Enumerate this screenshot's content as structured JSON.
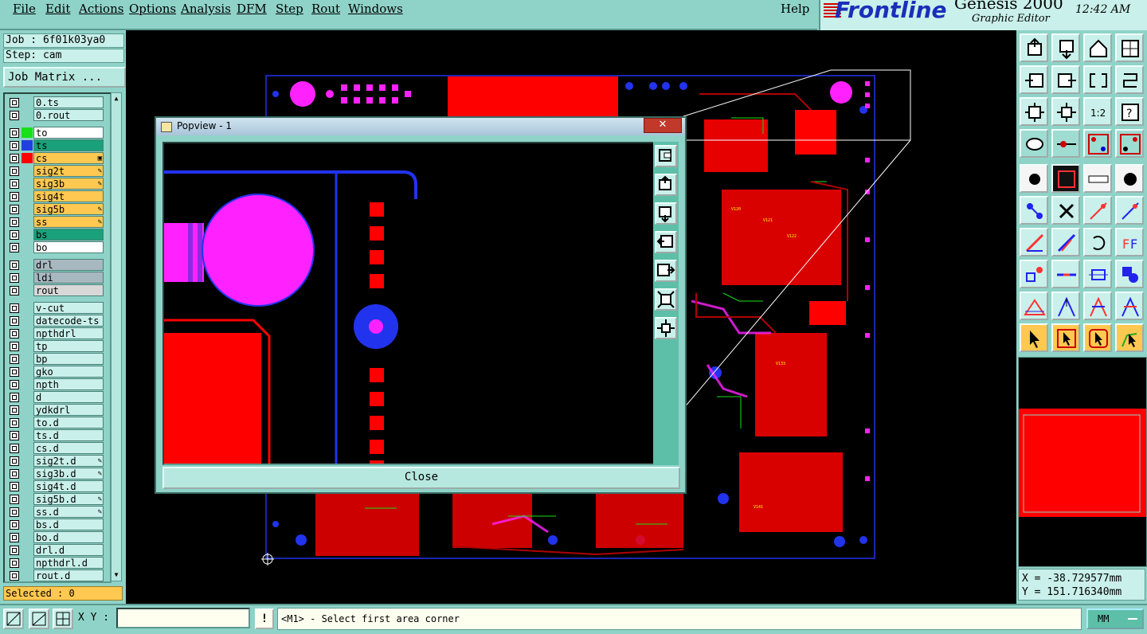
{
  "menu": {
    "items": [
      "File",
      "Edit",
      "Actions",
      "Options",
      "Analysis",
      "DFM",
      "Step",
      "Rout",
      "Windows"
    ],
    "help": "Help"
  },
  "brand": {
    "logo": "Frontline",
    "product": "Genesis 2000",
    "subtitle": "Graphic Editor",
    "clock": "12:42 AM"
  },
  "job": {
    "label": "Job : 6f01k03ya0",
    "step": "Step: cam",
    "matrix_button": "Job Matrix ..."
  },
  "layers": [
    {
      "name": "0.ts",
      "color": "#c9f0ea",
      "swatch": null,
      "mark": ""
    },
    {
      "name": "0.rout",
      "color": "#c9f0ea",
      "swatch": null,
      "mark": ""
    },
    {
      "name": "to",
      "color": "#ffffff",
      "swatch": "#18e018",
      "mark": ""
    },
    {
      "name": "ts",
      "color": "#1aa07a",
      "swatch": "#2040e0",
      "mark": ""
    },
    {
      "name": "cs",
      "color": "#ffc850",
      "swatch": "#ff0000",
      "mark": "▣"
    },
    {
      "name": "sig2t",
      "color": "#ffc850",
      "swatch": null,
      "mark": "✎"
    },
    {
      "name": "sig3b",
      "color": "#ffc850",
      "swatch": null,
      "mark": "✎"
    },
    {
      "name": "sig4t",
      "color": "#ffc850",
      "swatch": null,
      "mark": ""
    },
    {
      "name": "sig5b",
      "color": "#ffc850",
      "swatch": null,
      "mark": "✎"
    },
    {
      "name": "ss",
      "color": "#ffc850",
      "swatch": null,
      "mark": "✎"
    },
    {
      "name": "bs",
      "color": "#1aa07a",
      "swatch": null,
      "mark": ""
    },
    {
      "name": "bo",
      "color": "#ffffff",
      "swatch": null,
      "mark": ""
    },
    {
      "name": "drl",
      "color": "#a8b8c0",
      "swatch": null,
      "mark": ""
    },
    {
      "name": "ldi",
      "color": "#a8b8c0",
      "swatch": null,
      "mark": ""
    },
    {
      "name": "rout",
      "color": "#d8d8d8",
      "swatch": null,
      "mark": ""
    },
    {
      "name": "v-cut",
      "color": "#c9f0ea",
      "swatch": null,
      "mark": ""
    },
    {
      "name": "datecode-ts",
      "color": "#c9f0ea",
      "swatch": null,
      "mark": ""
    },
    {
      "name": "npthdrl",
      "color": "#c9f0ea",
      "swatch": null,
      "mark": ""
    },
    {
      "name": "tp",
      "color": "#c9f0ea",
      "swatch": null,
      "mark": ""
    },
    {
      "name": "bp",
      "color": "#c9f0ea",
      "swatch": null,
      "mark": ""
    },
    {
      "name": "gko",
      "color": "#c9f0ea",
      "swatch": null,
      "mark": ""
    },
    {
      "name": "npth",
      "color": "#c9f0ea",
      "swatch": null,
      "mark": ""
    },
    {
      "name": "d",
      "color": "#c9f0ea",
      "swatch": null,
      "mark": ""
    },
    {
      "name": "ydkdrl",
      "color": "#c9f0ea",
      "swatch": null,
      "mark": ""
    },
    {
      "name": "to.d",
      "color": "#c9f0ea",
      "swatch": null,
      "mark": ""
    },
    {
      "name": "ts.d",
      "color": "#c9f0ea",
      "swatch": null,
      "mark": ""
    },
    {
      "name": "cs.d",
      "color": "#c9f0ea",
      "swatch": null,
      "mark": ""
    },
    {
      "name": "sig2t.d",
      "color": "#c9f0ea",
      "swatch": null,
      "mark": "✎"
    },
    {
      "name": "sig3b.d",
      "color": "#c9f0ea",
      "swatch": null,
      "mark": "✎"
    },
    {
      "name": "sig4t.d",
      "color": "#c9f0ea",
      "swatch": null,
      "mark": ""
    },
    {
      "name": "sig5b.d",
      "color": "#c9f0ea",
      "swatch": null,
      "mark": "✎"
    },
    {
      "name": "ss.d",
      "color": "#c9f0ea",
      "swatch": null,
      "mark": "✎"
    },
    {
      "name": "bs.d",
      "color": "#c9f0ea",
      "swatch": null,
      "mark": ""
    },
    {
      "name": "bo.d",
      "color": "#c9f0ea",
      "swatch": null,
      "mark": ""
    },
    {
      "name": "drl.d",
      "color": "#c9f0ea",
      "swatch": null,
      "mark": ""
    },
    {
      "name": "npthdrl.d",
      "color": "#c9f0ea",
      "swatch": null,
      "mark": ""
    },
    {
      "name": "rout.d",
      "color": "#c9f0ea",
      "swatch": null,
      "mark": ""
    }
  ],
  "selected": "Selected : 0",
  "popview": {
    "title": "Popview - 1",
    "close_x": "✕",
    "close_button": "Close"
  },
  "coords": {
    "x": "X = -38.729577mm",
    "y": "Y = 151.716340mm"
  },
  "status": {
    "xy_label": "X Y :",
    "xy_value": "",
    "warn": "!",
    "prompt": "<M1> - Select first area corner",
    "units": "MM"
  },
  "colors": {
    "panel": "#8fd3c8",
    "canvas": "#000000",
    "accent": "#ffc850",
    "board_red": "#ff0000",
    "magenta": "#ff22ff",
    "blue": "#2233ee"
  }
}
